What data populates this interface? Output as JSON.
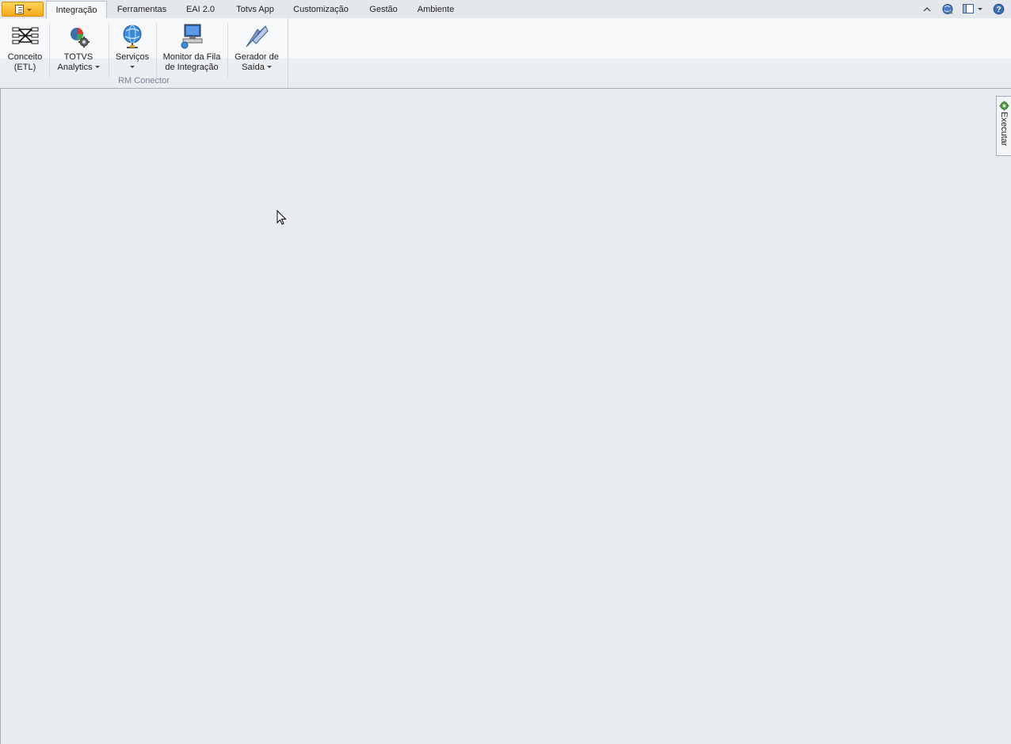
{
  "tabs": [
    {
      "label": "Integração",
      "active": true
    },
    {
      "label": "Ferramentas",
      "active": false
    },
    {
      "label": "EAI 2.0",
      "active": false
    },
    {
      "label": "Totvs App",
      "active": false
    },
    {
      "label": "Customização",
      "active": false
    },
    {
      "label": "Gestão",
      "active": false
    },
    {
      "label": "Ambiente",
      "active": false
    }
  ],
  "title_controls": [
    "minimize-ribbon-icon",
    "globe-icon",
    "layout-icon",
    "help-icon"
  ],
  "ribbon": {
    "group_label": "RM Conector",
    "buttons": [
      {
        "line1": "Conceito",
        "line2": "(ETL)",
        "dropdown": false,
        "icon": "etl-icon"
      },
      {
        "line1": "TOTVS",
        "line2": "Analytics",
        "dropdown": true,
        "icon": "analytics-icon"
      },
      {
        "line1": "Serviços",
        "line2": "",
        "dropdown": true,
        "icon": "services-globe-icon"
      },
      {
        "line1": "Monitor da Fila",
        "line2": "de Integração",
        "dropdown": false,
        "icon": "monitor-icon"
      },
      {
        "line1": "Gerador de",
        "line2": "Saída",
        "dropdown": true,
        "icon": "output-generator-icon"
      }
    ]
  },
  "side_panel": {
    "label": "Executar",
    "icon": "gear-icon"
  },
  "colors": {
    "app_button": "#f7a81d",
    "workspace": "#e8ebf0",
    "ribbon": "#f7f8fa"
  }
}
